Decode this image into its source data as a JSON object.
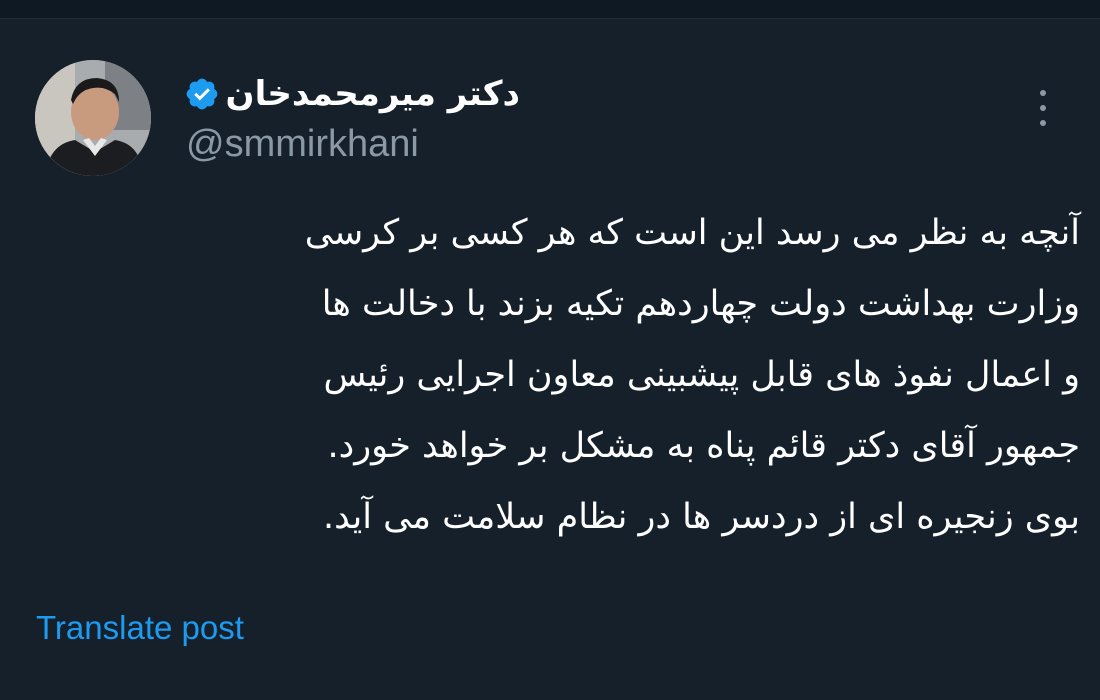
{
  "author": {
    "display_name": "دکتر میرمحمدخان",
    "handle": "@smmirkhani",
    "verified": true
  },
  "tweet": {
    "lines": [
      "آنچه به نظر می رسد این است که هر کسی بر کرسی",
      "وزارت بهداشت دولت چهاردهم تکیه بزند با دخالت ها",
      "و اعمال نفوذ های قابل پیشبینی معاون اجرایی رئیس",
      "جمهور آقای دکتر قائم پناه به مشکل بر خواهد خورد.",
      "بوی زنجیره ای از دردسر ها در نظام سلامت می آید."
    ]
  },
  "actions": {
    "translate_label": "Translate post"
  },
  "icons": {
    "verified": "verified-badge-icon",
    "more": "more-options-icon"
  },
  "colors": {
    "background": "#15202b",
    "text": "#ffffff",
    "muted": "#8b98a5",
    "accent": "#1d9bf0"
  }
}
